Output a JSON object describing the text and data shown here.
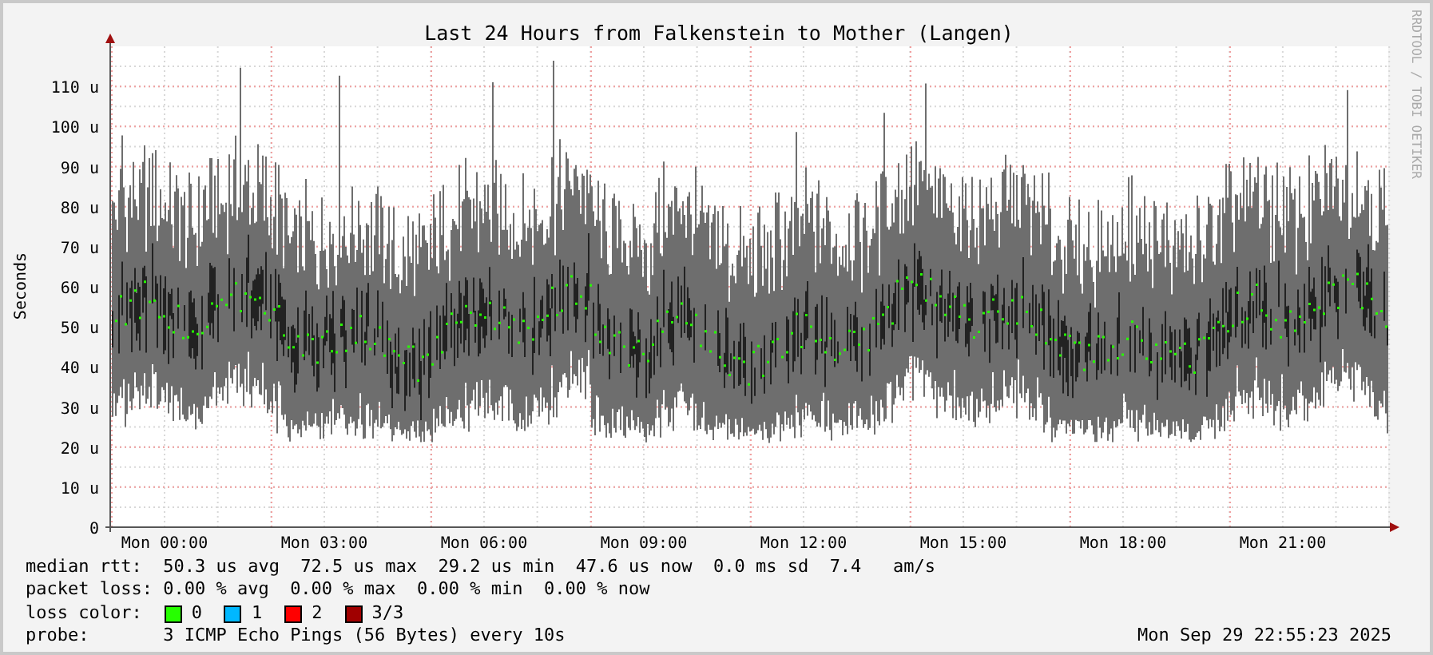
{
  "title": "Last 24 Hours from Falkenstein to Mother (Langen)",
  "y_axis": {
    "label": "Seconds",
    "ticks": [
      "110 u",
      "100 u",
      "90 u",
      "80 u",
      "70 u",
      "60 u",
      "50 u",
      "40 u",
      "30 u",
      "20 u",
      "10 u",
      "0"
    ]
  },
  "x_axis": {
    "ticks": [
      "Mon 00:00",
      "Mon 03:00",
      "Mon 06:00",
      "Mon 09:00",
      "Mon 12:00",
      "Mon 15:00",
      "Mon 18:00",
      "Mon 21:00"
    ]
  },
  "credit": "RRDTOOL / TOBI OETIKER",
  "legend": {
    "median_rtt": "median rtt:  50.3 us avg  72.5 us max  29.2 us min  47.6 us now  0.0 ms sd  7.4   am/s",
    "packet_loss": "packet loss: 0.00 % avg  0.00 % max  0.00 % min  0.00 % now",
    "loss_color_label": "loss color:",
    "loss_colors": [
      {
        "label": "0",
        "color": "#26ff00"
      },
      {
        "label": "1",
        "color": "#00b8ff"
      },
      {
        "label": "2",
        "color": "#ff0000"
      },
      {
        "label": "3/3",
        "color": "#a00000"
      }
    ],
    "probe": "probe:       3 ICMP Echo Pings (56 Bytes) every 10s",
    "timestamp": "Mon Sep 29 22:55:23 2025"
  }
}
